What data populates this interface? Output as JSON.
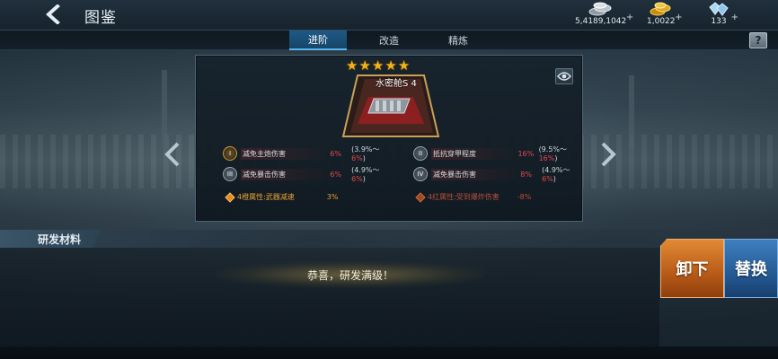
{
  "header": {
    "title": "图鉴",
    "currencies": [
      {
        "icon": "silver-coins-icon",
        "amount": "5,4189,1042"
      },
      {
        "icon": "gold-coins-icon",
        "amount": "1,0022"
      },
      {
        "icon": "diamond-icon",
        "amount": "133"
      }
    ]
  },
  "tabs": [
    {
      "label": "进阶",
      "active": true
    },
    {
      "label": "改造",
      "active": false
    },
    {
      "label": "精炼",
      "active": false
    }
  ],
  "help_label": "?",
  "item": {
    "name": "水密舱S 4",
    "stars": 5,
    "stats": [
      {
        "roman": "I",
        "name": "减免主炮伤害",
        "value": "6%",
        "range_prefix": "(3.9%～",
        "range_max": "6%",
        "range_suffix": ")"
      },
      {
        "roman": "II",
        "name": "抵抗穿甲程度",
        "value": "16%",
        "range_prefix": "(9.5%～",
        "range_max": "16%",
        "range_suffix": ")"
      },
      {
        "roman": "III",
        "name": "减免暴击伤害",
        "value": "6%",
        "range_prefix": "(4.9%～",
        "range_max": "6%",
        "range_suffix": ")"
      },
      {
        "roman": "IV",
        "name": "减免暴击伤害",
        "value": "8%",
        "range_prefix": "(4.9%～",
        "range_max": "6%",
        "range_suffix": ")"
      }
    ],
    "bonuses": [
      {
        "label": "4橙属性:武器减速",
        "value": "3%"
      },
      {
        "label": "4红属性:受到爆炸伤害",
        "value": "-8%"
      }
    ]
  },
  "section_title": "研发材料",
  "message": "恭喜，研发满级！",
  "buttons": {
    "unload": "卸下",
    "replace": "替换"
  },
  "colors": {
    "accent_tab": "#1e5a86",
    "star": "#f2b31a",
    "unload": "#c86a22",
    "replace": "#2c66a6",
    "stat_value": "#e04a4a"
  }
}
